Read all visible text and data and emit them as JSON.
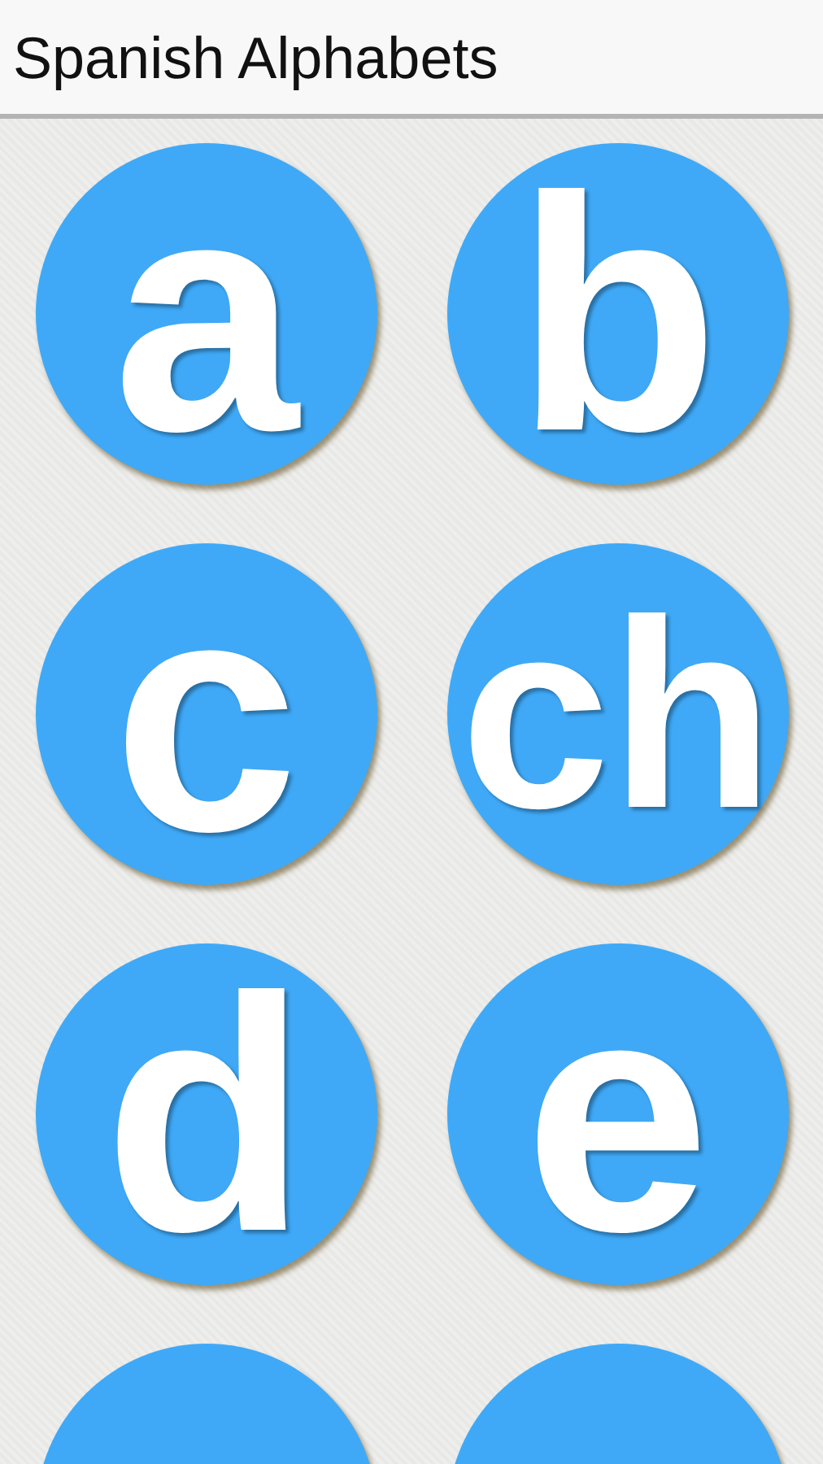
{
  "app_bar": {
    "title": "Spanish Alphabets"
  },
  "letters": [
    {
      "label": "a"
    },
    {
      "label": "b"
    },
    {
      "label": "c"
    },
    {
      "label": "ch"
    },
    {
      "label": "d"
    },
    {
      "label": "e"
    },
    {
      "kind": "cut_off"
    },
    {
      "kind": "cut_off"
    }
  ]
}
